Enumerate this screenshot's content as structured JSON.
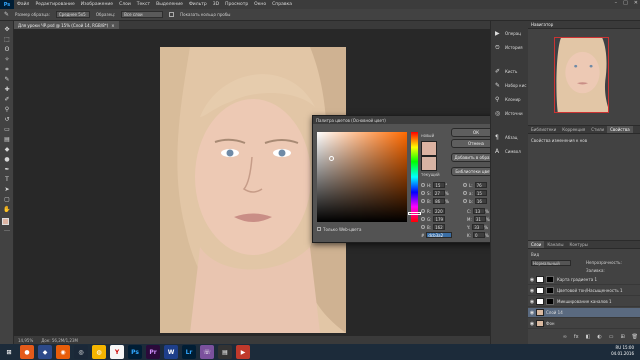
{
  "app": {
    "logo": "Ps",
    "menu": [
      "Файл",
      "Редактирование",
      "Изображение",
      "Слои",
      "Текст",
      "Выделение",
      "Фильтр",
      "3D",
      "Просмотр",
      "Окно",
      "Справка"
    ]
  },
  "options": {
    "sample_size_label": "Размер образца:",
    "sample_size_value": "Среднее 5x5",
    "sample_label": "Образец:",
    "sample_value": "Все слои",
    "show_ring": "Показать кольцо пробы"
  },
  "document_tab": {
    "label": "Для уроки ЧР.psd @ 15% (Слой 14, RGB/8*)",
    "close": "×"
  },
  "status": {
    "zoom": "14,95%",
    "doc": "Док: 56,2M/1,23M"
  },
  "dock": {
    "items": [
      "Операц",
      "История",
      "Кисть",
      "Набор кис",
      "Клонир",
      "Источни",
      "Абзац",
      "Символ"
    ]
  },
  "navigator": {
    "title": "Навигатор"
  },
  "properties": {
    "tabs": [
      "Библиотеки",
      "Коррекция",
      "Стили",
      "Свойства"
    ],
    "active": 3,
    "subtitle": "Свойства изменения к нов"
  },
  "layers": {
    "tabs": [
      "Слои",
      "Каналы",
      "Контуры"
    ],
    "filter_label": "Вид",
    "blend": "Нормальный",
    "opacity_label": "Непрозрачность:",
    "fill_label": "Заливка:",
    "rows": [
      {
        "name": "Карта градиента 1",
        "type": "adj"
      },
      {
        "name": "Цветовой тон/Насыщенность 1",
        "type": "adj"
      },
      {
        "name": "Микширование каналов 1",
        "type": "adj"
      },
      {
        "name": "Слой 14",
        "type": "photo",
        "selected": true
      },
      {
        "name": "Фон",
        "type": "photo"
      }
    ]
  },
  "color_picker": {
    "title": "Палитра цветов (Основной цвет)",
    "new_label": "новый",
    "current_label": "текущий",
    "ok": "ОК",
    "cancel": "Отмена",
    "add_swatch": "Добавить в образцы",
    "libraries": "Библиотеки цветов",
    "web_only": "Только Web-цвета",
    "hsb": [
      {
        "k": "H:",
        "v": "15",
        "u": "°"
      },
      {
        "k": "S:",
        "v": "27",
        "u": "%"
      },
      {
        "k": "B:",
        "v": "86",
        "u": "%"
      }
    ],
    "rgb": [
      {
        "k": "R:",
        "v": "220"
      },
      {
        "k": "G:",
        "v": "179"
      },
      {
        "k": "B:",
        "v": "162"
      }
    ],
    "lab": [
      {
        "k": "L:",
        "v": "76"
      },
      {
        "k": "a:",
        "v": "15"
      },
      {
        "k": "b:",
        "v": "16"
      }
    ],
    "cmyk": [
      {
        "k": "C:",
        "v": "13",
        "u": "%"
      },
      {
        "k": "M:",
        "v": "31",
        "u": "%"
      },
      {
        "k": "Y:",
        "v": "33",
        "u": "%"
      },
      {
        "k": "K:",
        "v": "0",
        "u": "%"
      }
    ],
    "hex_label": "#",
    "hex": "dcb3a2",
    "new_color": "#dcb3a2",
    "current_color": "#d7b3a3"
  },
  "tooltip": "Закрыть",
  "clock": {
    "time": "15:00",
    "date": "04.01.2016",
    "lang": "RU"
  },
  "colors": {
    "panel": "#424242",
    "accent": "#c9452a"
  }
}
